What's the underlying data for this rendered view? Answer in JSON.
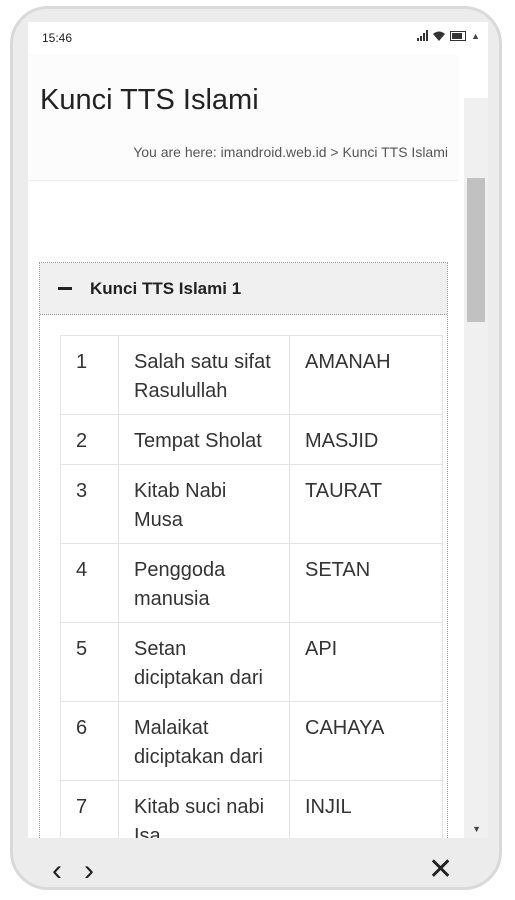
{
  "status": {
    "time": "15:46"
  },
  "header": {
    "title": "Kunci TTS Islami",
    "breadcrumb": "You are here: imandroid.web.id > Kunci TTS Islami"
  },
  "accordion": {
    "title": "Kunci TTS Islami 1",
    "rows": [
      {
        "no": "1",
        "question": "Salah satu sifat Rasulullah",
        "answer": "AMANAH"
      },
      {
        "no": "2",
        "question": "Tempat Sholat",
        "answer": "MASJID"
      },
      {
        "no": "3",
        "question": "Kitab Nabi Musa",
        "answer": "TAURAT"
      },
      {
        "no": "4",
        "question": "Penggoda manusia",
        "answer": "SETAN"
      },
      {
        "no": "5",
        "question": "Setan diciptakan dari",
        "answer": "API"
      },
      {
        "no": "6",
        "question": "Malaikat diciptakan dari",
        "answer": "CAHAYA"
      },
      {
        "no": "7",
        "question": "Kitab suci nabi Isa",
        "answer": "INJIL"
      }
    ]
  },
  "nav": {
    "back": "‹",
    "forward": "›",
    "close": "✕"
  }
}
